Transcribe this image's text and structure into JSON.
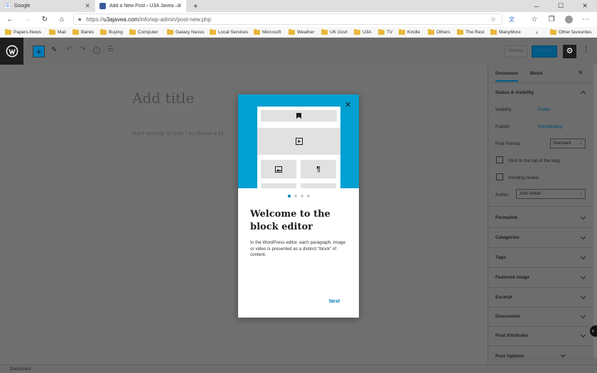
{
  "browser": {
    "tabs": [
      {
        "title": "Google",
        "favicon": "google-icon"
      },
      {
        "title": "Add a New Post ‹ U3A Javea — W",
        "favicon": "site-icon"
      }
    ],
    "new_tab_icon": "plus-icon",
    "url": {
      "scheme": "https://",
      "host": "u3ajavea.com",
      "path": "/info/wp-admin/post-new.php"
    },
    "bookmarks": [
      "Papers-News",
      "Mail",
      "Banks",
      "Buying",
      "Computer",
      "Galaxy Nexus",
      "Local Services",
      "Microsoft",
      "Weather",
      "UK Govt",
      "U3A",
      "TV",
      "Kindle",
      "Others",
      "The Rest",
      "ManyMore"
    ],
    "other_favourites": "Other favourites"
  },
  "editor": {
    "toolbar": {
      "preview": "Preview",
      "publish": "Publish"
    },
    "title_placeholder": "Add title",
    "body_placeholder": "Start writing or type / to choose a bl",
    "status": "Document"
  },
  "sidebar": {
    "tabs": {
      "document": "Document",
      "block": "Block"
    },
    "status_visibility": "Status & visibility",
    "visibility_label": "Visibility",
    "visibility_value": "Public",
    "publish_label": "Publish",
    "publish_value": "Immediately",
    "post_format_label": "Post Format",
    "post_format_value": "Standard",
    "sticky_label": "Stick to the top of the blog",
    "pending_label": "Pending review",
    "author_label": "Author",
    "author_value": "John Wilde",
    "panels": [
      "Permalink",
      "Categories",
      "Tags",
      "Featured image",
      "Excerpt",
      "Discussion",
      "Post Attributes",
      "Post Options"
    ]
  },
  "modal": {
    "title": "Welcome to the block editor",
    "text": "In the WordPress editor, each paragraph, image or video is presented as a distinct “block” of content.",
    "next": "Next",
    "page_index": 0,
    "page_count": 4
  },
  "colors": {
    "accent": "#007cba",
    "hero": "#00a0d2",
    "overlay": "#707070"
  }
}
